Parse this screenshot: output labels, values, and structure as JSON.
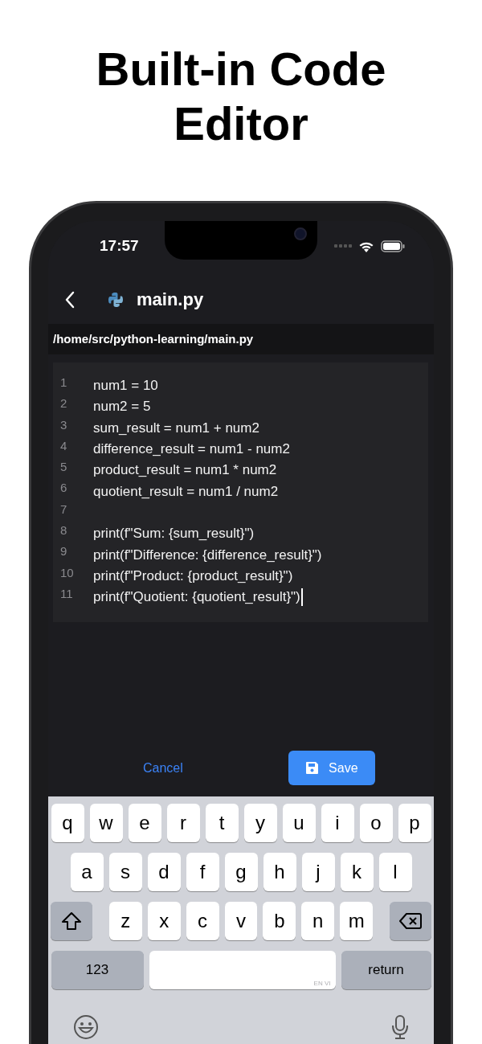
{
  "headline": "Built-in Code Editor",
  "status_bar": {
    "time": "17:57"
  },
  "nav": {
    "title": "main.py"
  },
  "path": "/home/src/python-learning/main.py",
  "editor": {
    "lines": [
      {
        "number": "1",
        "code": "num1 = 10",
        "cursor": false
      },
      {
        "number": "2",
        "code": "num2 = 5",
        "cursor": false
      },
      {
        "number": "3",
        "code": "sum_result = num1 + num2",
        "cursor": false
      },
      {
        "number": "4",
        "code": "difference_result = num1 - num2",
        "cursor": false
      },
      {
        "number": "5",
        "code": "product_result = num1 * num2",
        "cursor": false
      },
      {
        "number": "6",
        "code": "quotient_result = num1 / num2",
        "cursor": false
      },
      {
        "number": "7",
        "cursor": false
      },
      {
        "number": "8",
        "code": "print(f\"Sum: {sum_result}\")",
        "cursor": false
      },
      {
        "number": "9",
        "code": "print(f\"Difference: {difference_result}\")",
        "cursor": false
      },
      {
        "number": "10",
        "code": "print(f\"Product: {product_result}\")",
        "cursor": false
      },
      {
        "number": "11",
        "code": "print(f\"Quotient: {quotient_result}\")",
        "cursor": true
      }
    ]
  },
  "actions": {
    "cancel": "Cancel",
    "save": "Save"
  },
  "keyboard": {
    "top_row": [
      {
        "kind": "letter",
        "label": "q"
      },
      {
        "kind": "letter",
        "label": "w"
      },
      {
        "kind": "letter",
        "label": "e"
      },
      {
        "kind": "letter",
        "label": "r"
      },
      {
        "kind": "letter",
        "label": "t"
      },
      {
        "kind": "letter",
        "label": "y"
      },
      {
        "kind": "letter",
        "label": "u"
      },
      {
        "kind": "letter",
        "label": "i"
      },
      {
        "kind": "letter",
        "label": "o"
      },
      {
        "kind": "letter",
        "label": "p"
      }
    ],
    "middle_row": [
      {
        "kind": "letter",
        "label": "a"
      },
      {
        "kind": "letter",
        "label": "s"
      },
      {
        "kind": "letter",
        "label": "d"
      },
      {
        "kind": "letter",
        "label": "f"
      },
      {
        "kind": "letter",
        "label": "g"
      },
      {
        "kind": "letter",
        "label": "h"
      },
      {
        "kind": "letter",
        "label": "j"
      },
      {
        "kind": "letter",
        "label": "k"
      },
      {
        "kind": "letter",
        "label": "l"
      }
    ],
    "lower_row": [
      {
        "kind": "shift"
      },
      {
        "kind": "letter",
        "label": "z"
      },
      {
        "kind": "letter",
        "label": "x"
      },
      {
        "kind": "letter",
        "label": "c"
      },
      {
        "kind": "letter",
        "label": "v"
      },
      {
        "kind": "letter",
        "label": "b"
      },
      {
        "kind": "letter",
        "label": "n"
      },
      {
        "kind": "letter",
        "label": "m"
      },
      {
        "kind": "delete"
      }
    ],
    "function_keys": [
      {
        "kind": "numbers",
        "label": "123"
      },
      {
        "kind": "space",
        "label": "EN VI"
      },
      {
        "kind": "return",
        "label": "return"
      }
    ],
    "extras": [
      {
        "kind": "emoji"
      },
      {
        "kind": "mic"
      }
    ]
  }
}
